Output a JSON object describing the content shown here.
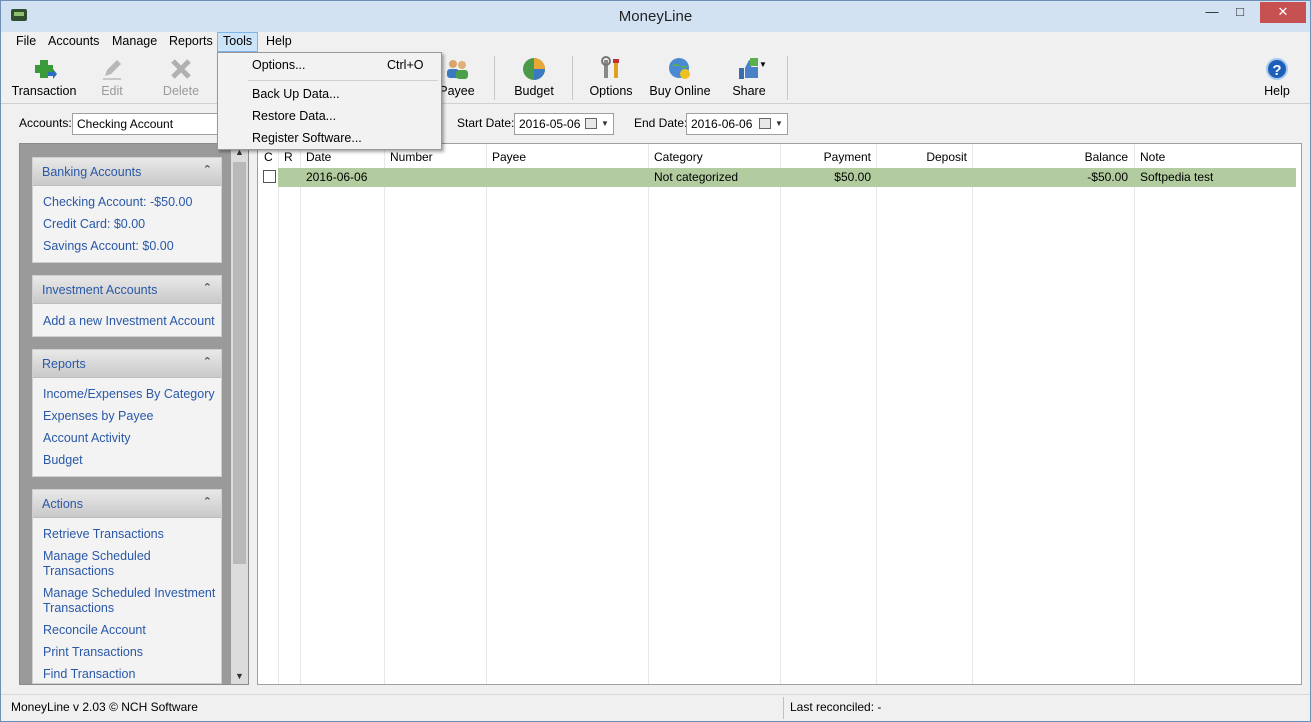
{
  "window": {
    "title": "MoneyLine"
  },
  "menubar": {
    "items": [
      "File",
      "Accounts",
      "Manage",
      "Reports",
      "Tools",
      "Help"
    ]
  },
  "toolbar": {
    "transaction": "Transaction",
    "edit": "Edit",
    "delete": "Delete",
    "payee": "Payee",
    "budget": "Budget",
    "options": "Options",
    "buy_online": "Buy Online",
    "share": "Share",
    "help": "Help"
  },
  "tools_menu": {
    "options": "Options...",
    "options_shortcut": "Ctrl+O",
    "backup": "Back Up Data...",
    "restore": "Restore Data...",
    "register": "Register Software..."
  },
  "filter": {
    "accounts_label": "Accounts:",
    "account_value": "Checking Account",
    "start_label": "Start Date:",
    "start_value": "2016-05-06",
    "end_label": "End Date:",
    "end_value": "2016-06-06"
  },
  "sidebar": {
    "banking": {
      "title": "Banking Accounts",
      "links": [
        "Checking Account: -$50.00",
        "Credit Card: $0.00",
        "Savings Account: $0.00"
      ]
    },
    "investment": {
      "title": "Investment Accounts",
      "links": [
        "Add a new Investment Account"
      ]
    },
    "reports": {
      "title": "Reports",
      "links": [
        "Income/Expenses By Category",
        "Expenses by Payee",
        "Account Activity",
        "Budget"
      ]
    },
    "actions": {
      "title": "Actions",
      "links": [
        "Retrieve Transactions",
        "Manage Scheduled Transactions",
        "Manage Scheduled Investment Transactions",
        "Reconcile Account",
        "Print Transactions",
        "Find Transaction"
      ]
    }
  },
  "grid": {
    "columns": [
      "C",
      "R",
      "Date",
      "Number",
      "Payee",
      "Category",
      "Payment",
      "Deposit",
      "Balance",
      "Note"
    ],
    "rows": [
      {
        "date": "2016-06-06",
        "number": "",
        "payee": "",
        "category": "Not categorized",
        "payment": "$50.00",
        "deposit": "",
        "balance": "-$50.00",
        "note": "Softpedia test"
      }
    ]
  },
  "status": {
    "version": "MoneyLine v 2.03 © NCH Software",
    "reconciled": "Last reconciled: -"
  },
  "colors": {
    "row_highlight": "#b2cc9f",
    "link": "#2a58a8",
    "close_button": "#c75050"
  }
}
